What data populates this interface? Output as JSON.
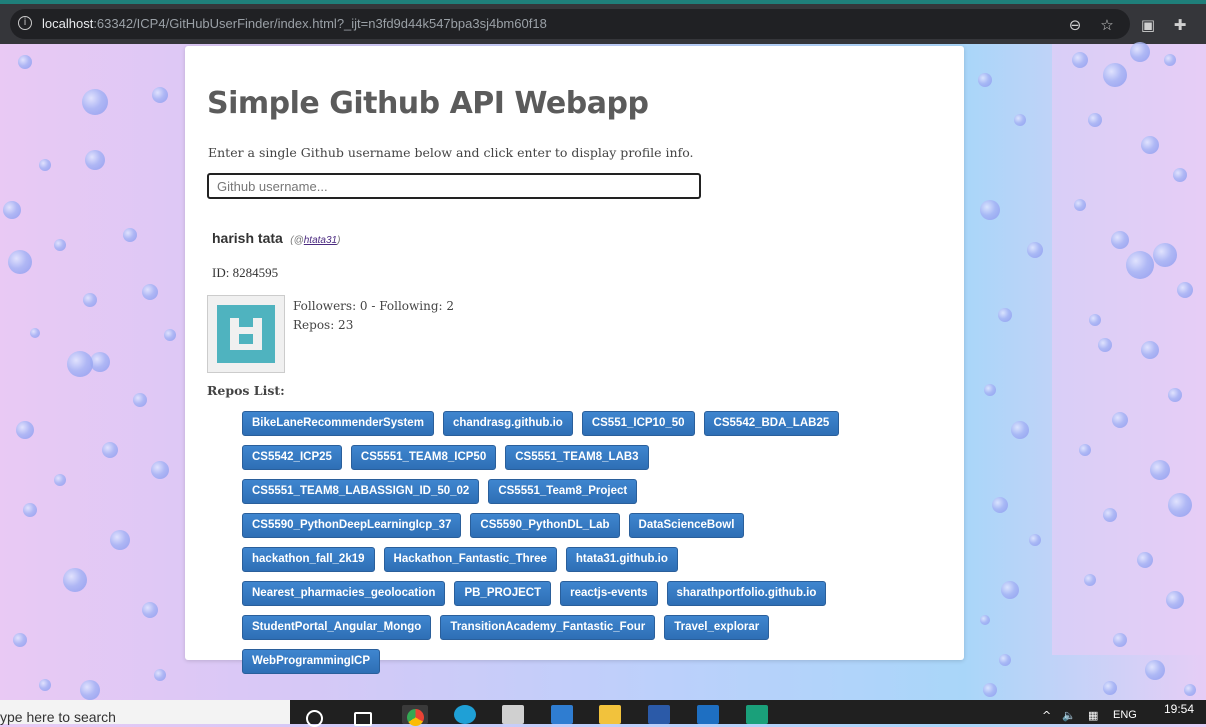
{
  "browser": {
    "url_host": "localhost",
    "url_rest": ":63342/ICP4/GitHubUserFinder/index.html?_ijt=n3fd9d44k547bpa3sj4bm60f18",
    "icons": [
      "info-icon",
      "zoom-out-icon",
      "bookmark-star-icon",
      "extension-square-icon",
      "puzzle-icon"
    ]
  },
  "page": {
    "title": "Simple Github API Webapp",
    "subtitle": "Enter a single Github username below and click enter to display profile info.",
    "search_placeholder": "Github username..."
  },
  "profile": {
    "full_name": "harish tata",
    "handle_prefix": "(@",
    "handle": "htata31",
    "handle_suffix": ")",
    "id_text": "ID: 8284595",
    "followers_text": "Followers: 0 - Following: 2",
    "repos_text": "Repos: 23",
    "avatar_color": "#4fb3bf"
  },
  "repos_heading": "Repos List:",
  "repos": [
    "BikeLaneRecommenderSystem",
    "chandrasg.github.io",
    "CS551_ICP10_50",
    "CS5542_BDA_LAB25",
    "CS5542_ICP25",
    "CS5551_TEAM8_ICP50",
    "CS5551_TEAM8_LAB3",
    "CS5551_TEAM8_LABASSIGN_ID_50_02",
    "CS5551_Team8_Project",
    "CS5590_PythonDeepLearningIcp_37",
    "CS5590_PythonDL_Lab",
    "DataScienceBowl",
    "hackathon_fall_2k19",
    "Hackathon_Fantastic_Three",
    "htata31.github.io",
    "Nearest_pharmacies_geolocation",
    "PB_PROJECT",
    "reactjs-events",
    "sharathportfolio.github.io",
    "StudentPortal_Angular_Mongo",
    "TransitionAcademy_Fantastic_Four",
    "Travel_explorar",
    "WebProgrammingICP"
  ],
  "taskbar": {
    "search_text": "ype here to search",
    "language": "ENG",
    "time": "19:54"
  },
  "colors": {
    "repo_button": "#3a7cc4",
    "title": "#5b5b5b"
  }
}
